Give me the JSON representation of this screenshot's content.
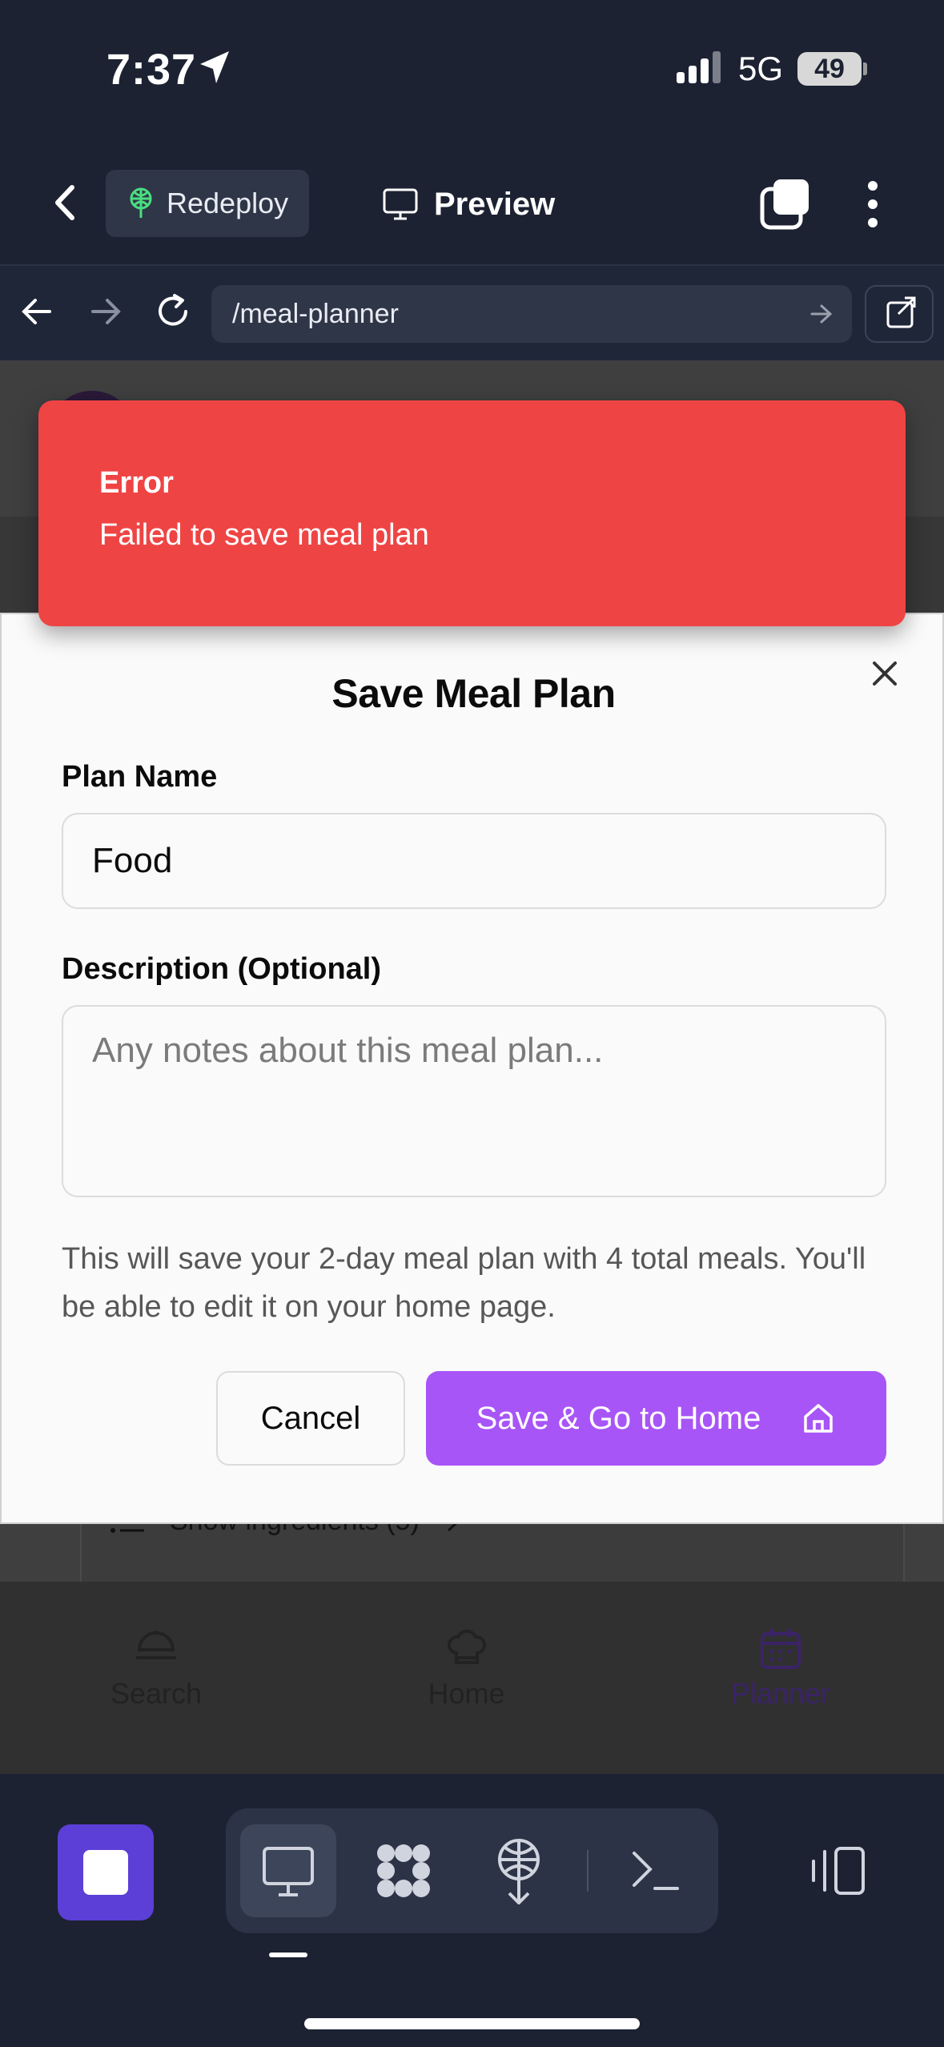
{
  "status_bar": {
    "time": "7:37",
    "network": "5G",
    "battery": "49"
  },
  "header": {
    "redeploy_label": "Redeploy",
    "preview_label": "Preview"
  },
  "url_bar": {
    "path": "/meal-planner"
  },
  "background_page": {
    "ingredients_toggle": "Show ingredients (5)",
    "nav": [
      {
        "label": "Search",
        "icon": "search-food-icon"
      },
      {
        "label": "Home",
        "icon": "chef-hat-icon"
      },
      {
        "label": "Planner",
        "icon": "calendar-icon",
        "active": true
      }
    ]
  },
  "toast": {
    "title": "Error",
    "message": "Failed to save meal plan",
    "color": "#ef4444"
  },
  "modal": {
    "title": "Save Meal Plan",
    "name_label": "Plan Name",
    "name_value": "Food",
    "description_label": "Description (Optional)",
    "description_placeholder": "Any notes about this meal plan...",
    "info_text": "This will save your 2-day meal plan with 4 total meals. You'll be able to edit it on your home page.",
    "cancel_label": "Cancel",
    "save_label": "Save & Go to Home",
    "accent": "#a855f7"
  },
  "dock": {
    "items": [
      "stop-icon",
      "desktop-icon",
      "apps-icon",
      "deploy-icon",
      "terminal-icon",
      "panel-icon"
    ]
  }
}
